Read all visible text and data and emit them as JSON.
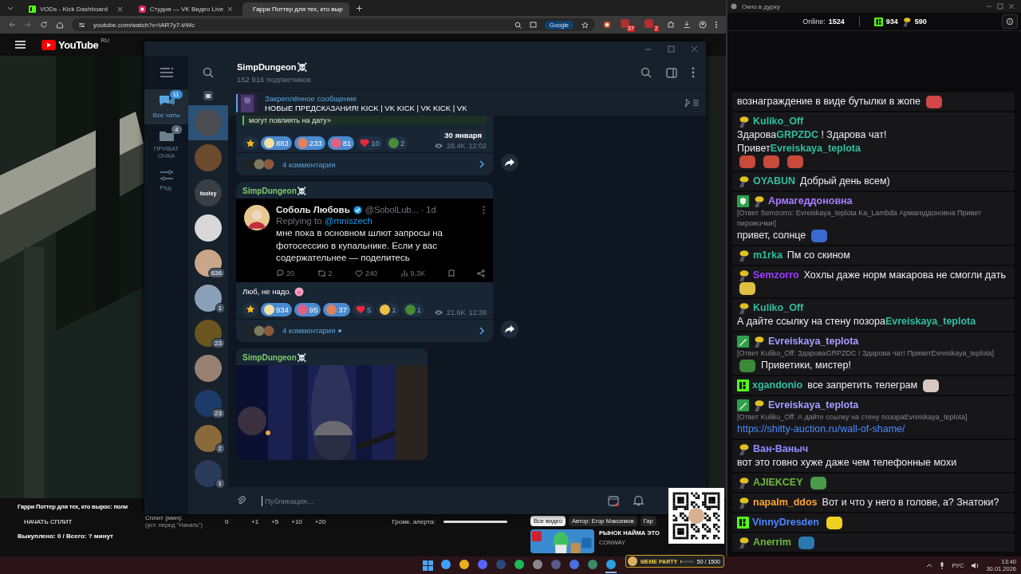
{
  "browser": {
    "tabs": [
      {
        "title": "VODs - Kick Dashboard",
        "selected": false,
        "kind": "kick"
      },
      {
        "title": "Студия — VK Видео Live",
        "selected": false,
        "kind": "vk"
      },
      {
        "title": "Гарри Поттер для тех, кто выр",
        "selected": true,
        "kind": "youtube"
      }
    ],
    "address": "youtube.com/watch?v=IAR7y7-t/Wc",
    "search_chip": "Google",
    "extension_badges": [
      "37",
      "2"
    ]
  },
  "youtube": {
    "logo": "YouTube",
    "region": "RU",
    "video_title": "Гарри Поттер для тех, кто вырос: поли",
    "split_button": "НАЧАТЬ СПЛИТ",
    "split_label": "Сплит (мин):",
    "split_hint": "(уст. перед \"Начать\")",
    "split_value": "0",
    "increments": [
      "+1",
      "+5",
      "+10",
      "+20"
    ],
    "volume_label": "Громк. алерта:",
    "volume": {
      "level": 1
    },
    "bought": "Выкуплено: 0 / Всего: ? минут",
    "chips": [
      {
        "label": "Все видео",
        "selected": true
      },
      {
        "label": "Автор: Егор Максимов",
        "selected": false
      },
      {
        "label": "Гар",
        "selected": false
      }
    ],
    "video_card": {
      "title": "РЫНОК НАЙМА ЭТО",
      "channel": "CONWAY"
    }
  },
  "telegram": {
    "folders": [
      {
        "label": "Все чаты",
        "badge": "11",
        "selected": true,
        "kind": "chats"
      },
      {
        "label": "ПРИВАТ ОЧКА",
        "badge": "4",
        "selected": false,
        "kind": "folder"
      },
      {
        "label": "Ред.",
        "selected": false,
        "kind": "edit"
      }
    ],
    "chats": [
      {
        "color": "#4a4d52",
        "selected": true
      },
      {
        "color": "#6b4a2e",
        "selected": false
      },
      {
        "color": "#3a3e45",
        "label": "toolsy",
        "selected": false
      },
      {
        "color": "#d8d8d8",
        "selected": false
      },
      {
        "color": "#c9a68a",
        "badge": "636",
        "selected": false
      },
      {
        "color": "#8aa0b8",
        "badge": "1",
        "selected": false
      },
      {
        "color": "#6a5520",
        "badge": "23",
        "selected": false
      },
      {
        "color": "#9a8070",
        "selected": false
      },
      {
        "color": "#1d3b6a",
        "badge": "23",
        "selected": false
      },
      {
        "color": "#8a6a3a",
        "badge": "2",
        "selected": false
      },
      {
        "color": "#2a3a5a",
        "badge": "1",
        "selected": false
      }
    ],
    "channel": "SimpDungeon☠️",
    "subscribers": "152 916 подписчиков",
    "pinned_title": "Закреплённое сообщение",
    "pinned_text": "НОВЫЕ ПРЕДСКАЗАНИЯ!  KICK | VK KICK | VK KICK | VK",
    "posts": [
      {
        "kind": "tail",
        "text": "могут повлиять на дату»",
        "date": "30 января",
        "views": "28.4K",
        "time": "12:02",
        "comments": "4 комментария",
        "unread": false,
        "reactions": [
          {
            "kind": "star",
            "selected": false
          },
          {
            "kind": "emoji",
            "color": "#f0e0a0",
            "count": "883",
            "selected": true
          },
          {
            "kind": "emoji",
            "color": "#e08060",
            "count": "233",
            "selected": true
          },
          {
            "kind": "emoji",
            "color": "#e06080",
            "count": "81",
            "selected": true
          },
          {
            "kind": "heart",
            "count": "10",
            "selected": false
          },
          {
            "kind": "emoji",
            "color": "#4a8a3a",
            "count": "2",
            "selected": false
          }
        ]
      },
      {
        "kind": "tweet",
        "author": "SimpDungeon☠️",
        "caption": "Люб, не надо.",
        "views": "21.6K",
        "time": "12:38",
        "comments": "4 комментария",
        "unread": true,
        "tweet": {
          "name": "Соболь Любовь",
          "handle": "@SobolLub... · 1d",
          "replying": "Replying to",
          "reply_to": "@mniszech",
          "text": "мне пока в основном шлют запросы на фотосессию в купальнике. Если у вас содержательнее — поделитесь",
          "stats": [
            {
              "kind": "reply",
              "count": "20"
            },
            {
              "kind": "retweet",
              "count": "2"
            },
            {
              "kind": "like",
              "count": "240"
            },
            {
              "kind": "views",
              "count": "9,3K"
            },
            {
              "kind": "bookmark"
            },
            {
              "kind": "share"
            }
          ]
        },
        "reactions": [
          {
            "kind": "star",
            "selected": false
          },
          {
            "kind": "emoji",
            "color": "#f0e0a0",
            "count": "934",
            "selected": true
          },
          {
            "kind": "emoji",
            "color": "#e06080",
            "count": "95",
            "selected": true
          },
          {
            "kind": "emoji",
            "color": "#e08060",
            "count": "37",
            "selected": true
          },
          {
            "kind": "heart",
            "count": "5",
            "selected": false
          },
          {
            "kind": "emoji",
            "color": "#f0c040",
            "count": "1",
            "selected": false
          },
          {
            "kind": "emoji",
            "color": "#4a8a3a",
            "count": "1",
            "selected": false
          }
        ]
      },
      {
        "author": "SimpDungeon☠️"
      }
    ],
    "input_placeholder": "Публикация..."
  },
  "chat": {
    "title": "Окно в дурку",
    "online_label": "Online:",
    "online": "1524",
    "kick_count": "934",
    "worm_count": "590",
    "messages": [
      {
        "parts": [
          {
            "kind": "text",
            "text": "вознаграждение в виде бутылки в жопе"
          },
          {
            "kind": "emote",
            "color": "#d04848"
          }
        ]
      },
      {
        "badges": [
          {
            "kind": "worm"
          }
        ],
        "name": "Kuliko_Off",
        "color": "#2fbf9f",
        "parts": [
          {
            "kind": "text",
            "text": "Здарова"
          },
          {
            "kind": "mention",
            "text": "GRPZDC"
          },
          {
            "kind": "text",
            "text": " ! Здарова чат! Привет"
          },
          {
            "kind": "mention",
            "text": "Evreiskaya_teplota"
          },
          {
            "kind": "emote",
            "color": "#c84a3a"
          },
          {
            "kind": "emote",
            "color": "#c84a3a"
          },
          {
            "kind": "emote",
            "color": "#c84a3a"
          }
        ]
      },
      {
        "badges": [
          {
            "kind": "worm"
          }
        ],
        "name": "OYABUN",
        "color": "#2fbf9f",
        "parts": [
          {
            "kind": "text",
            "text": "Добрый день всем)"
          }
        ]
      },
      {
        "badges": [
          {
            "kind": "mod"
          },
          {
            "kind": "worm"
          }
        ],
        "name": "Армагеддоновна",
        "color": "#a77cff",
        "reply": "[Ответ Semzorro: Evreiskaya_teplota Ka_Lambda Армагеддоновна Привет пирожочки!]",
        "parts": [
          {
            "kind": "text",
            "text": "привет, солнце"
          },
          {
            "kind": "emote",
            "color": "#3a6ad0"
          }
        ]
      },
      {
        "badges": [
          {
            "kind": "worm"
          }
        ],
        "name": "m1rka",
        "color": "#2fbf9f",
        "parts": [
          {
            "kind": "text",
            "text": "Пм со скином"
          }
        ]
      },
      {
        "badges": [
          {
            "kind": "worm"
          }
        ],
        "name": "Semzorro",
        "color": "#9b3cff",
        "parts": [
          {
            "kind": "text",
            "text": "Хохлы даже норм макарова не смогли дать"
          },
          {
            "kind": "emote",
            "color": "#e0c040"
          }
        ]
      },
      {
        "badges": [
          {
            "kind": "worm"
          }
        ],
        "name": "Kuliko_Off",
        "color": "#2fbf9f",
        "parts": [
          {
            "kind": "text",
            "text": "А дайте ссылку на стену позора"
          },
          {
            "kind": "mention",
            "text": "Evreiskaya_teplota"
          }
        ]
      },
      {
        "badges": [
          {
            "kind": "vip"
          },
          {
            "kind": "worm"
          }
        ],
        "name": "Evreiskaya_teplota",
        "color": "#a89bff",
        "reply": "[Ответ Kuliko_Off: ЗдароваGRPZDC ! Здарова чат! ПриветEvreiskaya_teplota]",
        "parts": [
          {
            "kind": "emote",
            "color": "#3a8a3a"
          },
          {
            "kind": "text",
            "text": "Приветики, мистер!"
          }
        ]
      },
      {
        "badges": [
          {
            "kind": "kick"
          }
        ],
        "name": "xgandonio",
        "color": "#2fbf9f",
        "parts": [
          {
            "kind": "text",
            "text": "все запретить телеграм"
          },
          {
            "kind": "emote",
            "color": "#d8c8c0"
          }
        ]
      },
      {
        "badges": [
          {
            "kind": "vip"
          },
          {
            "kind": "worm"
          }
        ],
        "name": "Evreiskaya_teplota",
        "color": "#a89bff",
        "reply": "[Ответ Kuliko_Off: А дайте ссылку на стену позораEvreiskaya_teplota]",
        "parts": [
          {
            "kind": "link",
            "text": "https://shitty-auction.ru/wall-of-shame/"
          }
        ]
      },
      {
        "badges": [
          {
            "kind": "worm"
          }
        ],
        "name": "Ван-Ваныч",
        "color": "#8f8cff",
        "parts": [
          {
            "kind": "text",
            "text": "вот это говно хуже даже чем телефонные мохи"
          }
        ]
      },
      {
        "badges": [
          {
            "kind": "worm"
          }
        ],
        "name": "AJIEKCEY",
        "color": "#6cba3c",
        "parts": [
          {
            "kind": "emote",
            "color": "#4a9a4a"
          }
        ]
      },
      {
        "badges": [
          {
            "kind": "worm"
          }
        ],
        "name": "napalm_ddos",
        "color": "#ffa42e",
        "parts": [
          {
            "kind": "text",
            "text": "Вот и что у него в голове, а? Знатоки?"
          }
        ]
      },
      {
        "badges": [
          {
            "kind": "kick"
          }
        ],
        "name": "VinnyDresden",
        "color": "#4a86ff",
        "parts": [
          {
            "kind": "emote",
            "color": "#f0d020"
          }
        ]
      },
      {
        "badges": [
          {
            "kind": "worm"
          }
        ],
        "name": "Anerrim",
        "color": "#6cba3c",
        "parts": [
          {
            "kind": "emote",
            "color": "#2a7ab0"
          }
        ]
      }
    ]
  },
  "taskbar": {
    "apps": [
      {
        "color": "#3fa0ff",
        "active": false
      },
      {
        "color": "#e8b020",
        "active": false
      },
      {
        "color": "#5865f2",
        "active": false
      },
      {
        "color": "#2a4a7a",
        "active": false
      },
      {
        "color": "#1db954",
        "active": false
      },
      {
        "color": "#888888",
        "active": false
      },
      {
        "color": "#5a5a8a",
        "active": false
      },
      {
        "color": "#4a70e0",
        "active": false
      },
      {
        "color": "#3a8a6a",
        "active": false
      },
      {
        "color": "#2aa0e0",
        "active": true
      }
    ],
    "meme_party": {
      "label": "MEME PARTY",
      "progress": "50 / 1500",
      "level": 0.03
    },
    "lang": "РУС",
    "time": "13:40",
    "date": "30.01.2026"
  }
}
